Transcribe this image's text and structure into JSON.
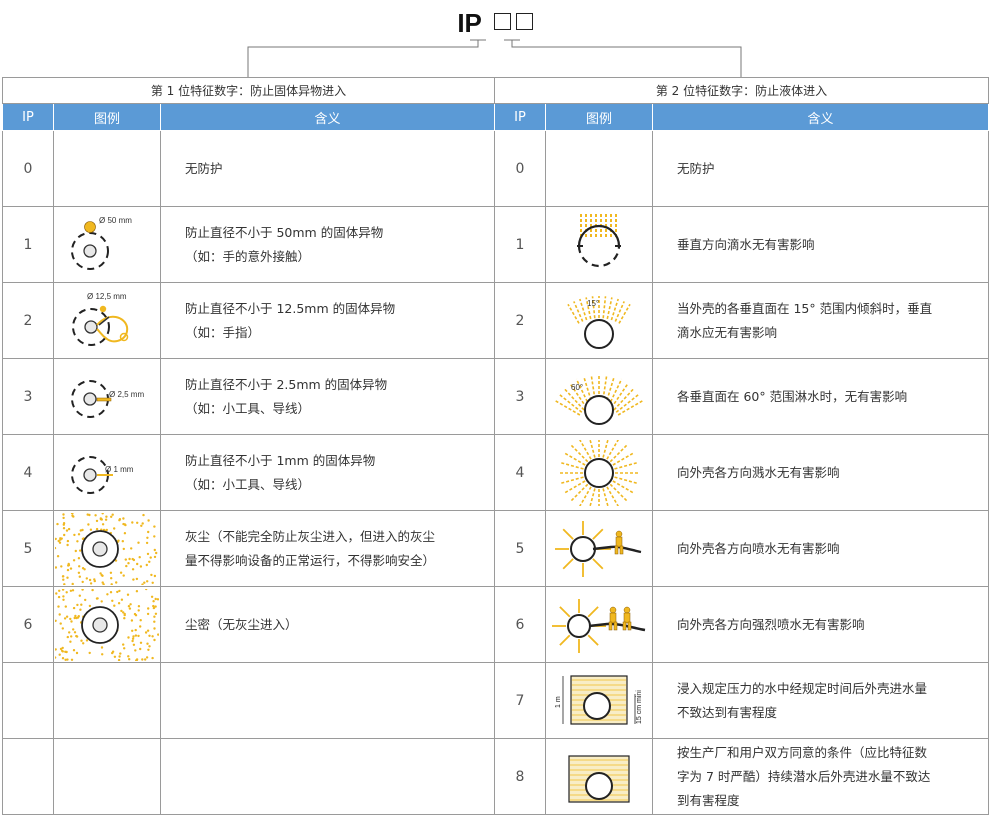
{
  "header": {
    "ip": "IP"
  },
  "left_section": "第 1 位特征数字：防止固体异物进入",
  "right_section": "第 2 位特征数字：防止液体进入",
  "columns": {
    "ip": "IP",
    "figure": "图例",
    "meaning": "含义"
  },
  "solid": [
    {
      "ip": "0",
      "icon": "none",
      "meaning": [
        "无防护"
      ]
    },
    {
      "ip": "1",
      "icon": "solid-50mm-icon",
      "label": "Ø 50 mm",
      "meaning": [
        "防止直径不小于 50mm 的固体异物",
        "（如：手的意外接触）"
      ]
    },
    {
      "ip": "2",
      "icon": "solid-12mm-icon",
      "label": "Ø 12,5 mm",
      "meaning": [
        "防止直径不小于 12.5mm 的固体异物",
        "（如：手指）"
      ]
    },
    {
      "ip": "3",
      "icon": "solid-2mm-icon",
      "label": "Ø 2,5 mm",
      "meaning": [
        "防止直径不小于 2.5mm 的固体异物",
        "（如：小工具、导线）"
      ]
    },
    {
      "ip": "4",
      "icon": "solid-1mm-icon",
      "label": "Ø 1 mm",
      "meaning": [
        "防止直径不小于 1mm 的固体异物",
        "（如：小工具、导线）"
      ]
    },
    {
      "ip": "5",
      "icon": "dust-protected-icon",
      "meaning": [
        "灰尘（不能完全防止灰尘进入，但进入的灰尘",
        "量不得影响设备的正常运行，不得影响安全）"
      ]
    },
    {
      "ip": "6",
      "icon": "dust-tight-icon",
      "meaning": [
        "尘密（无灰尘进入）"
      ]
    },
    {
      "ip": "",
      "icon": "none",
      "meaning": []
    },
    {
      "ip": "",
      "icon": "none",
      "meaning": []
    }
  ],
  "liquid": [
    {
      "ip": "0",
      "icon": "none",
      "meaning": [
        "无防护"
      ]
    },
    {
      "ip": "1",
      "icon": "vertical-drip-icon",
      "meaning": [
        "垂直方向滴水无有害影响"
      ]
    },
    {
      "ip": "2",
      "icon": "drip-15deg-icon",
      "label": "15°",
      "meaning": [
        "当外壳的各垂直面在 15° 范围内倾斜时，垂直",
        "滴水应无有害影响"
      ]
    },
    {
      "ip": "3",
      "icon": "spray-60deg-icon",
      "label": "60°",
      "meaning": [
        "各垂直面在 60° 范围淋水时，无有害影响"
      ]
    },
    {
      "ip": "4",
      "icon": "splash-icon",
      "meaning": [
        "向外壳各方向溅水无有害影响"
      ]
    },
    {
      "ip": "5",
      "icon": "water-jet-icon",
      "meaning": [
        "向外壳各方向喷水无有害影响"
      ]
    },
    {
      "ip": "6",
      "icon": "powerful-jet-icon",
      "meaning": [
        "向外壳各方向强烈喷水无有害影响"
      ]
    },
    {
      "ip": "7",
      "icon": "immersion-icon",
      "labels": [
        "1 m",
        "15 cm mini"
      ],
      "meaning": [
        "浸入规定压力的水中经规定时间后外壳进水量",
        "不致达到有害程度"
      ]
    },
    {
      "ip": "8",
      "icon": "submersion-icon",
      "meaning": [
        "按生产厂和用户双方同意的条件（应比特征数",
        "字为 7 时严酷）持续潜水后外壳进水量不致达",
        "到有害程度"
      ]
    }
  ],
  "colors": {
    "header_bg": "#5b9ad6",
    "accent": "#f0b820",
    "border": "#9a9a9a"
  }
}
